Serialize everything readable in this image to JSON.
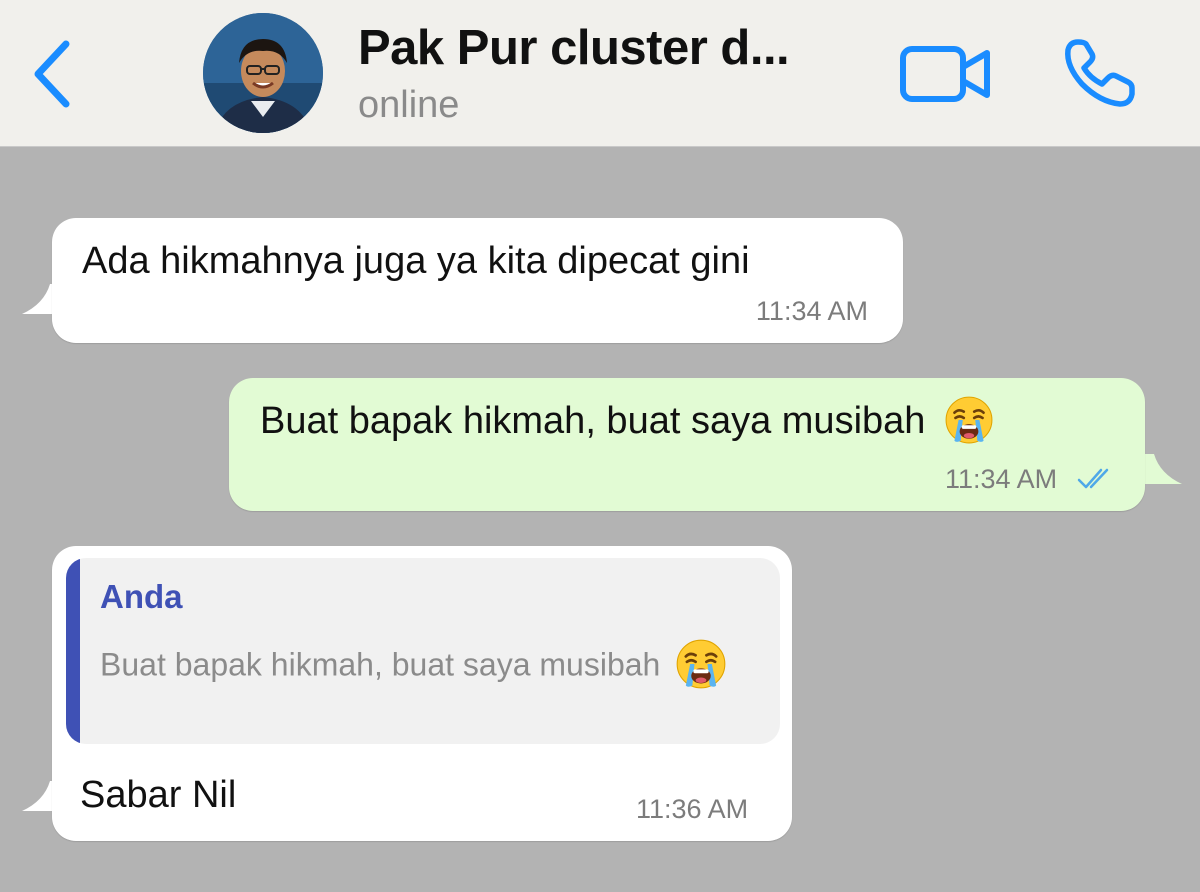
{
  "header": {
    "contact_name": "Pak Pur cluster d...",
    "status": "online"
  },
  "messages": [
    {
      "direction": "incoming",
      "text": "Ada hikmahnya juga ya kita dipecat gini",
      "time": "11:34 AM"
    },
    {
      "direction": "outgoing",
      "text": "Buat bapak hikmah, buat saya musibah",
      "emoji": "loudly-crying-face",
      "time": "11:34 AM",
      "read_receipt": "double-check-read"
    },
    {
      "direction": "incoming",
      "reply_to": {
        "author": "Anda",
        "text": "Buat bapak hikmah, buat saya musibah",
        "emoji": "loudly-crying-face"
      },
      "text": "Sabar Nil",
      "time": "11:36 AM"
    }
  ],
  "colors": {
    "accent": "#1a8cff",
    "header_bg": "#f1f0ec",
    "chat_bg": "#b3b3b3",
    "incoming_bubble": "#ffffff",
    "outgoing_bubble": "#e2fbd4",
    "quote_accent": "#3f51b5",
    "read_receipt": "#4fa8e8"
  }
}
